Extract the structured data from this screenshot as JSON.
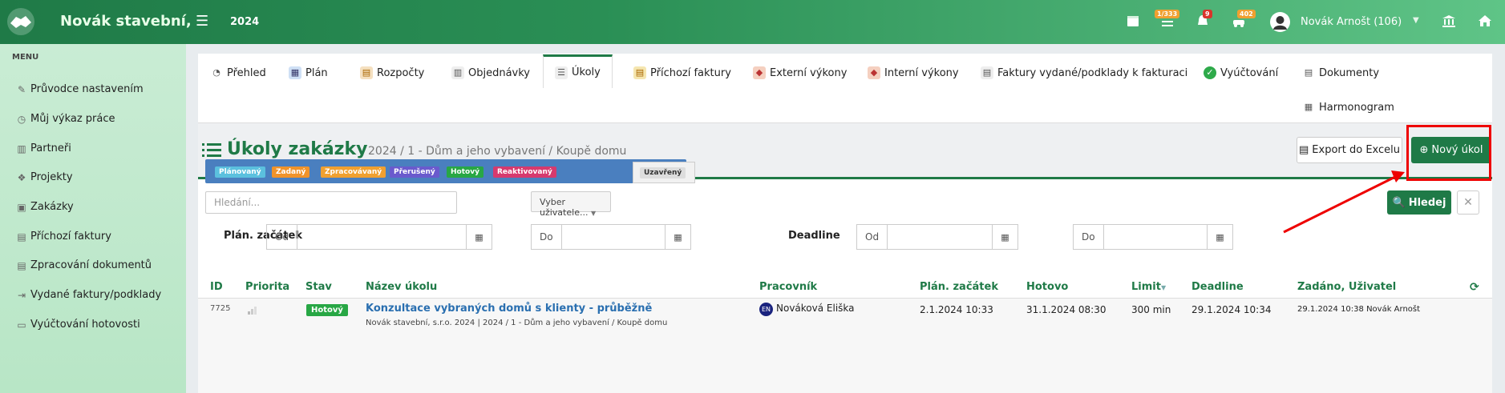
{
  "header": {
    "brand": "Novák stavební,",
    "year": "2024",
    "badges": {
      "tasks": "1/333",
      "notifications": "9",
      "vehicles": "402"
    },
    "user": "Novák Arnošt (106)"
  },
  "sidebar": {
    "menu_title": "MENU",
    "items": [
      {
        "label": "Průvodce nastavením",
        "icon": "pencil-icon"
      },
      {
        "label": "Můj výkaz práce",
        "icon": "clock-icon"
      },
      {
        "label": "Partneři",
        "icon": "building-icon"
      },
      {
        "label": "Projekty",
        "icon": "cubes-icon"
      },
      {
        "label": "Zakázky",
        "icon": "cube-icon"
      },
      {
        "label": "Příchozí faktury",
        "icon": "file-icon"
      },
      {
        "label": "Zpracování dokumentů",
        "icon": "document-icon"
      },
      {
        "label": "Vydané faktury/podklady",
        "icon": "export-icon"
      },
      {
        "label": "Vyúčtování hotovosti",
        "icon": "cash-icon"
      }
    ]
  },
  "tabs": [
    {
      "label": "Přehled"
    },
    {
      "label": "Plán"
    },
    {
      "label": "Rozpočty"
    },
    {
      "label": "Objednávky"
    },
    {
      "label": "Úkoly"
    },
    {
      "label": "Příchozí faktury"
    },
    {
      "label": "Externí výkony"
    },
    {
      "label": "Interní výkony"
    },
    {
      "label": "Faktury vydané/podklady k fakturaci"
    },
    {
      "label": "Vyúčtování"
    },
    {
      "label": "Dokumenty"
    },
    {
      "label": "Harmonogram"
    }
  ],
  "page": {
    "title": "Úkoly zakázky",
    "subtitle": "2024 / 1 - Dům a jeho vybavení / Koupě domu",
    "export_label": "Export do Excelu",
    "new_label": "Nový úkol"
  },
  "statuses": [
    "Plánovaný",
    "Zadaný",
    "Zpracovávaný",
    "Přerušený",
    "Hotový",
    "Reaktivovaný",
    "Uzavřený"
  ],
  "filters": {
    "search_placeholder": "Hledání...",
    "user_select": "Vyber uživatele...",
    "search_button": "Hledej",
    "plan_start_label": "Plán. začátek",
    "deadline_label": "Deadline",
    "from": "Od",
    "to": "Do"
  },
  "table": {
    "headers": [
      "ID",
      "Priorita",
      "Stav",
      "Název úkolu",
      "Pracovník",
      "Plán. začátek",
      "Hotovo",
      "Limit",
      "Deadline",
      "Zadáno, Uživatel"
    ],
    "rows": [
      {
        "id": "7725",
        "status": "Hotový",
        "name": "Konzultace vybraných domů s klienty - průběžně",
        "project": "Novák stavební, s.r.o. 2024 | 2024 / 1 - Dům a jeho vybavení / Koupě domu",
        "worker_initials": "EN",
        "worker": "Nováková Eliška",
        "plan_start": "2.1.2024 10:33",
        "done": "31.1.2024 08:30",
        "limit": "300 min",
        "deadline": "29.1.2024 10:34",
        "assigned": "29.1.2024 10:38 Novák Arnošt"
      }
    ]
  }
}
